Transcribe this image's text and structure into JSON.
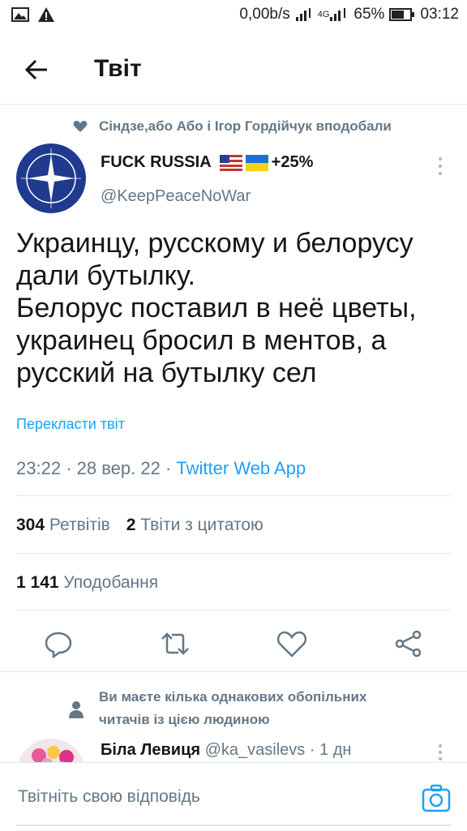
{
  "status_bar": {
    "network_speed": "0,00b/s",
    "network_type": "4G",
    "battery": "65%",
    "time": "03:12"
  },
  "header": {
    "title": "Твіт",
    "back_icon": "arrow-left-icon"
  },
  "social_context": {
    "text": "Сіндзе,або Або і Ігор Гордійчук вподобали",
    "icon": "heart-icon"
  },
  "tweet": {
    "author_name": "FUCK RUSSIA",
    "name_suffix": "+25%",
    "handle": "@KeepPeaceNoWar",
    "lines": [
      "Украинцу, русскому и белорусу",
      "дали бутылку.",
      "Белорус поставил в неё цветы,",
      "украинец бросил в ментов, а",
      "русский на бутылку сел"
    ],
    "translate": "Перекласти твіт",
    "time": "23:22",
    "date": "28 вер. 22",
    "source": "Twitter Web App",
    "retweets_count": "304",
    "retweets_label": "Ретвітів",
    "quotes_count": "2",
    "quotes_label": "Твіти з цитатою",
    "likes_count": "1 141",
    "likes_label": "Уподобання"
  },
  "follow_note": {
    "line1": "Ви маєте кілька однакових обопільних",
    "line2": "читачів із цією людиною"
  },
  "reply": {
    "name": "Біла Левиця",
    "handle": "@ka_vasilevs",
    "time": "1 дн"
  },
  "compose": {
    "placeholder": "Твітніть свою відповідь"
  },
  "colors": {
    "accent": "#1da1f2",
    "muted": "#657786",
    "text": "#14171a",
    "divider": "#e1e8ed"
  }
}
